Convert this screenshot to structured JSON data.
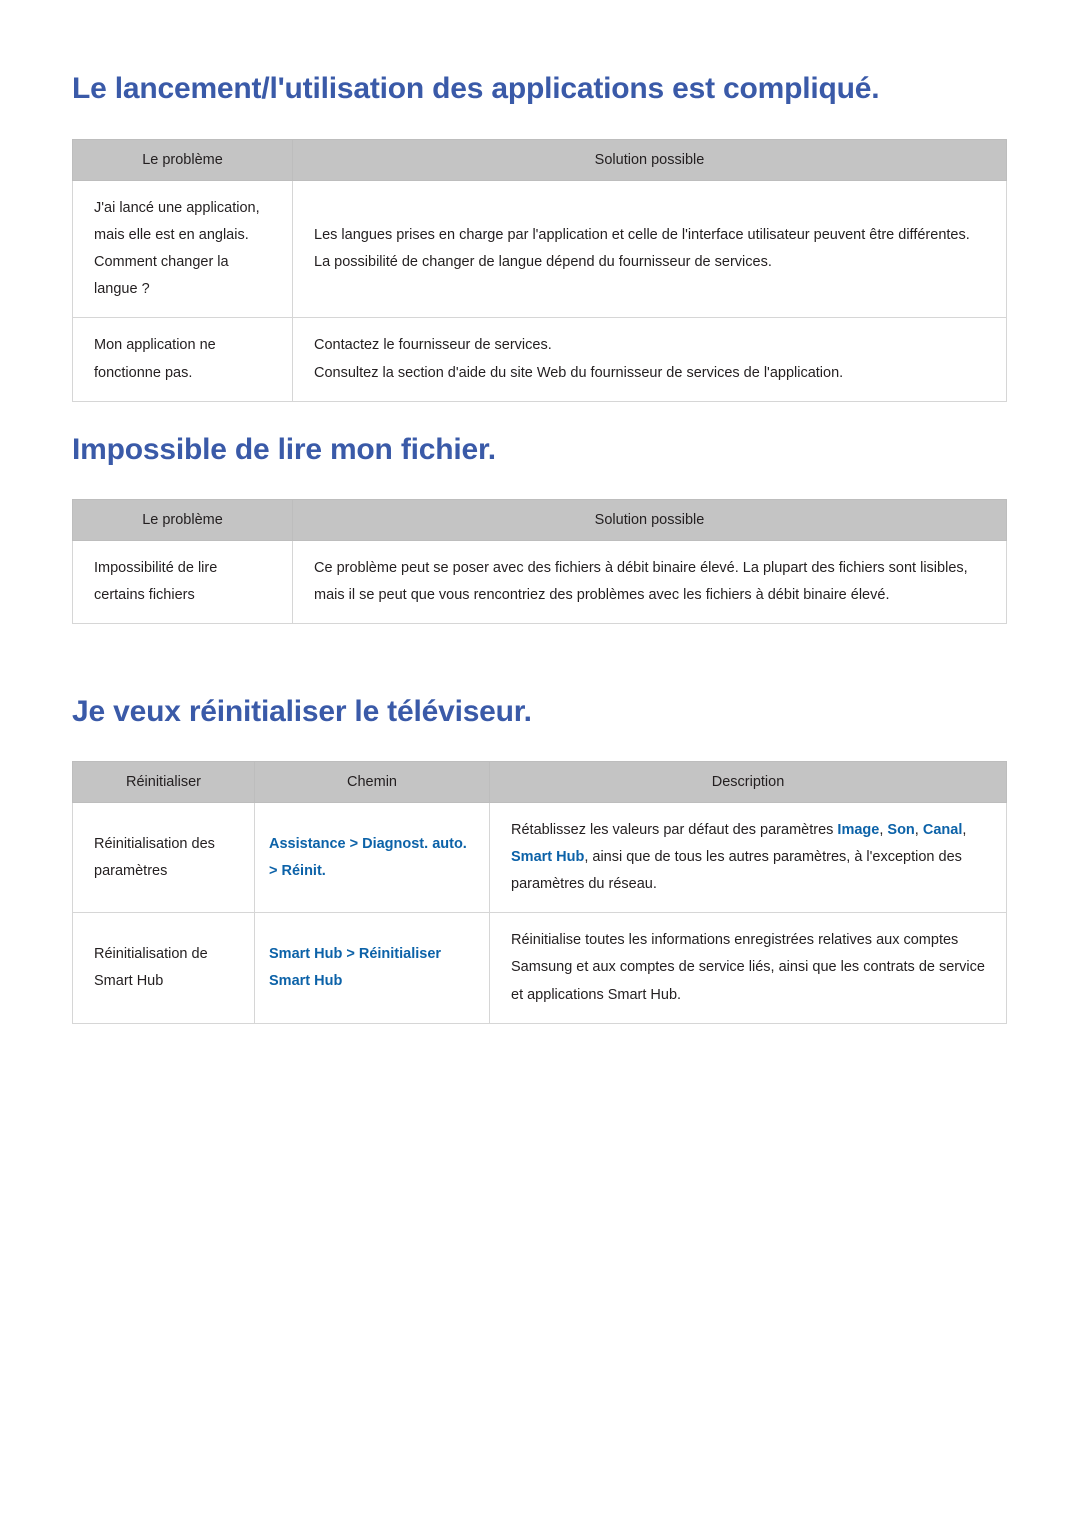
{
  "document": {
    "language": "fr",
    "heading_color": "#3a5aa8",
    "link_color": "#0c62a8",
    "header_row_color": "#c4c4c4"
  },
  "sections": [
    {
      "heading": "Le lancement/l'utilisation des applications est compliqué.",
      "table": {
        "headers": [
          "Le problème",
          "Solution possible"
        ],
        "rows": [
          {
            "problem": "J'ai lancé une application, mais elle est en anglais. Comment changer la langue ?",
            "solution_lines": [
              "Les langues prises en charge par l'application et celle de l'interface utilisateur peuvent être différentes. La possibilité de changer de langue dépend du fournisseur de services."
            ]
          },
          {
            "problem": "Mon application ne fonctionne pas.",
            "solution_lines": [
              "Contactez le fournisseur de services.",
              "Consultez la section d'aide du site Web du fournisseur de services de l'application."
            ]
          }
        ]
      }
    },
    {
      "heading": "Impossible de lire mon fichier.",
      "table": {
        "headers": [
          "Le problème",
          "Solution possible"
        ],
        "rows": [
          {
            "problem": "Impossibilité de lire certains fichiers",
            "solution_lines": [
              "Ce problème peut se poser avec des fichiers à débit binaire élevé. La plupart des fichiers sont lisibles, mais il se peut que vous rencontriez des problèmes avec les fichiers à débit binaire élevé."
            ]
          }
        ]
      }
    },
    {
      "heading": "Je veux réinitialiser le téléviseur.",
      "table": {
        "headers": [
          "Réinitialiser",
          "Chemin",
          "Description"
        ],
        "rows": [
          {
            "reset": "Réinitialisation des paramètres",
            "path_parts": [
              {
                "text": "Assistance",
                "style": "link"
              },
              {
                "text": " > ",
                "style": "separator"
              },
              {
                "text": "Diagnost. auto.",
                "style": "link"
              },
              {
                "text": " > ",
                "style": "separator"
              },
              {
                "text": "Réinit.",
                "style": "link"
              }
            ],
            "description_parts": [
              {
                "text": "Rétablissez les valeurs par défaut des paramètres ",
                "style": "plain"
              },
              {
                "text": "Image",
                "style": "term"
              },
              {
                "text": ", ",
                "style": "plain"
              },
              {
                "text": "Son",
                "style": "term"
              },
              {
                "text": ", ",
                "style": "plain"
              },
              {
                "text": "Canal",
                "style": "term"
              },
              {
                "text": ", ",
                "style": "plain"
              },
              {
                "text": "Smart Hub",
                "style": "term"
              },
              {
                "text": ", ainsi que de tous les autres paramètres, à l'exception des paramètres du réseau.",
                "style": "plain"
              }
            ]
          },
          {
            "reset": "Réinitialisation de Smart Hub",
            "path_parts": [
              {
                "text": "Smart Hub",
                "style": "link"
              },
              {
                "text": " > ",
                "style": "separator"
              },
              {
                "text": "Réinitialiser Smart Hub",
                "style": "link"
              }
            ],
            "description_parts": [
              {
                "text": "Réinitialise toutes les informations enregistrées relatives aux comptes Samsung et aux comptes de service liés, ainsi que les contrats de service et applications Smart Hub.",
                "style": "plain"
              }
            ]
          }
        ]
      }
    }
  ]
}
